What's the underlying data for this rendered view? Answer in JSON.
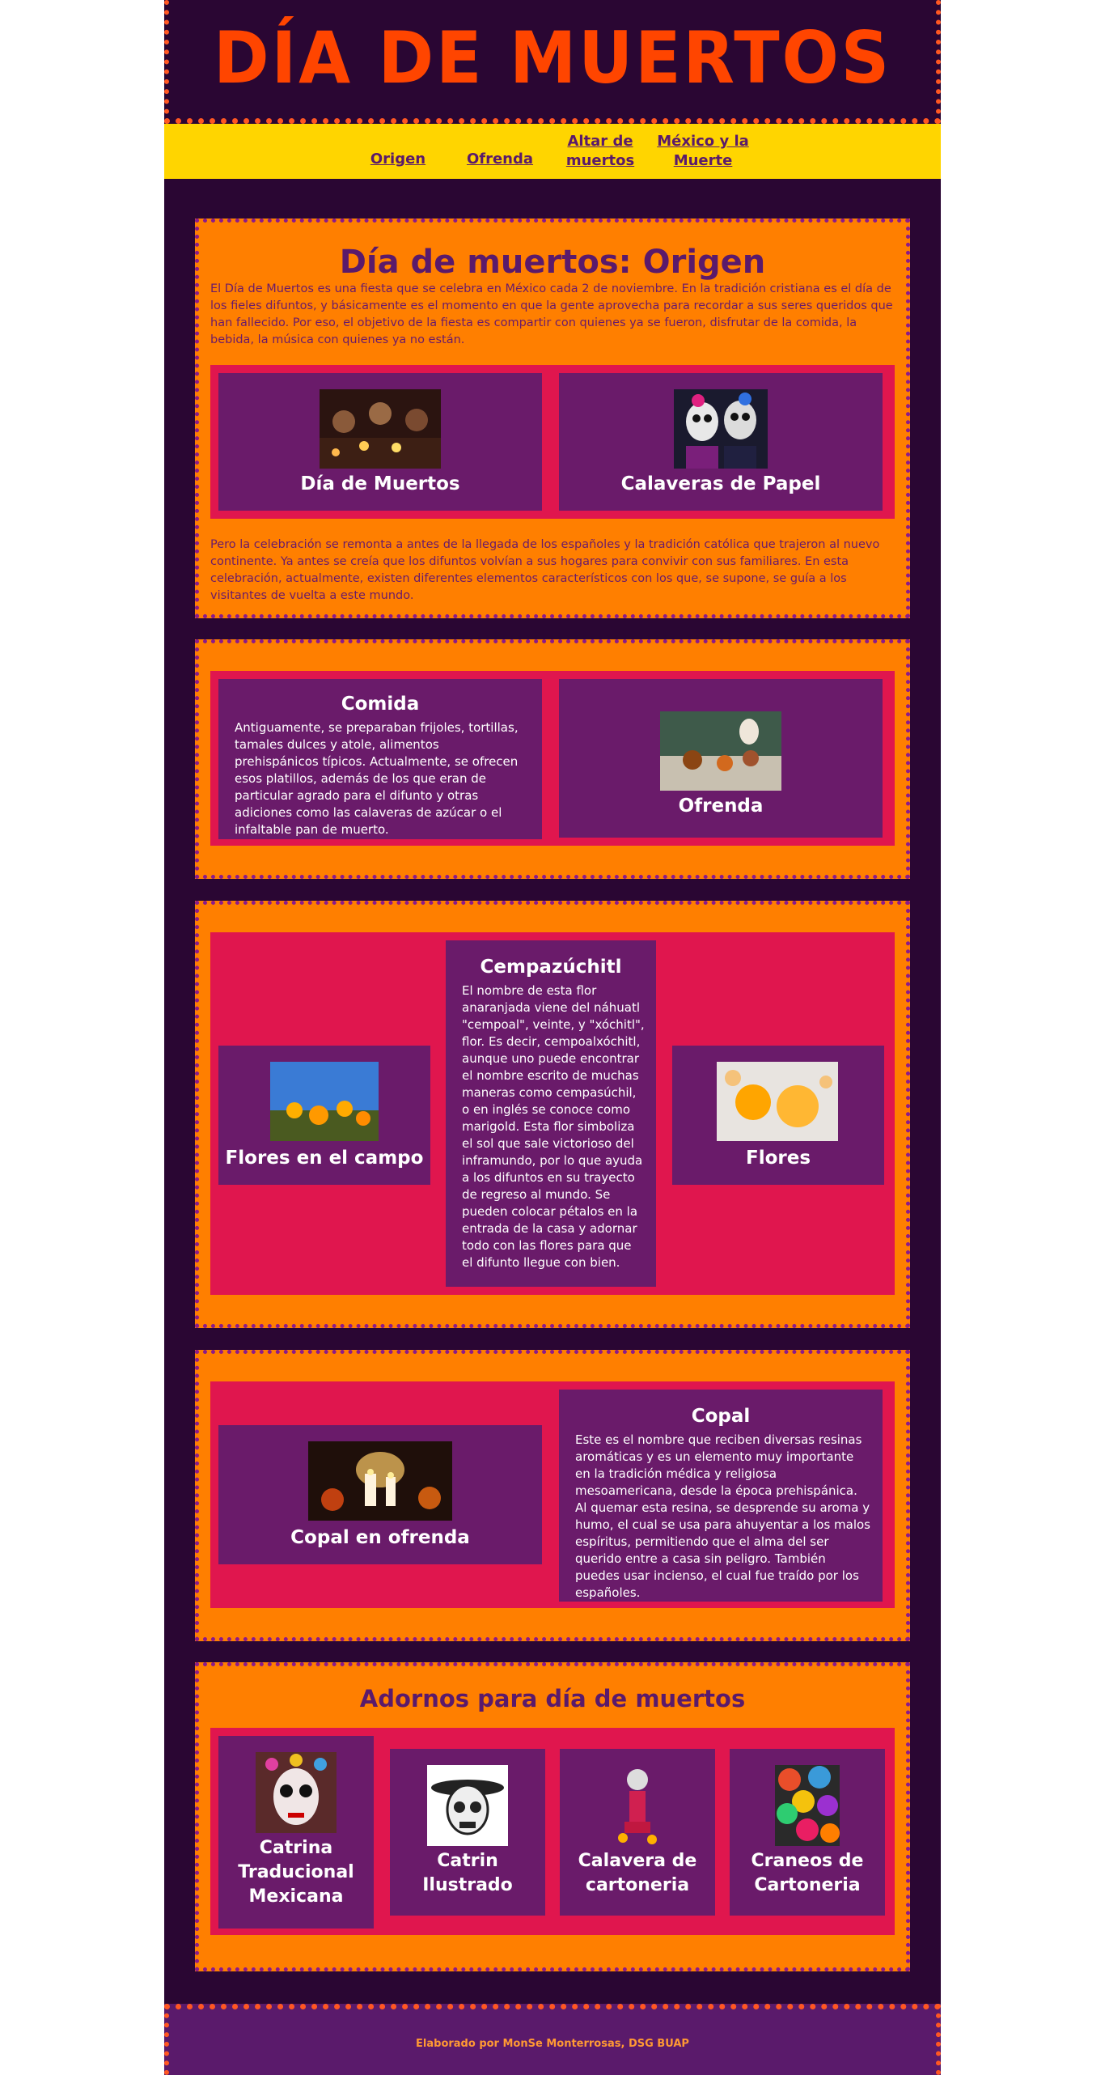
{
  "header": {
    "title": "DÍA DE MUERTOS"
  },
  "nav": {
    "items": [
      {
        "label": "Origen"
      },
      {
        "label": "Ofrenda"
      },
      {
        "label": "Altar de muertos"
      },
      {
        "label": "México y la Muerte"
      }
    ]
  },
  "origen": {
    "heading": "Día de muertos: Origen",
    "intro": "El Día de Muertos es una fiesta que se celebra en México cada 2 de noviembre. En la tradición cristiana es el día de los fieles difuntos, y básicamente es el momento en que la gente aprovecha para recordar a sus seres queridos que han fallecido. Por eso, el objetivo de la fiesta es compartir con quienes ya se fueron, disfrutar de la comida, la bebida, la música con quienes ya no están.",
    "cards": [
      {
        "title": "Día de Muertos"
      },
      {
        "title": "Calaveras de Papel"
      }
    ],
    "outro": "Pero la celebración se remonta a antes de la llegada de los españoles y la tradición católica que trajeron al nuevo continente. Ya antes se creía que los difuntos volvían a sus hogares para convivir con sus familiares. En esta celebración, actualmente, existen diferentes elementos característicos con los que, se supone, se guía a los visitantes de vuelta a este mundo."
  },
  "comida": {
    "title": "Comida",
    "text": "Antiguamente, se preparaban frijoles, tortillas, tamales dulces y atole, alimentos prehispánicos típicos. Actualmente, se ofrecen esos platillos, además de los que eran de particular agrado para el difunto y otras adiciones como las calaveras de azúcar o el infaltable pan de muerto.",
    "image_card": {
      "title": "Ofrenda"
    }
  },
  "cempazuchitl": {
    "left_card": {
      "title": "Flores en el campo"
    },
    "center": {
      "title": "Cempazúchitl",
      "text": "El nombre de esta flor anaranjada viene del náhuatl \"cempoal\", veinte, y \"xóchitl\", flor. Es decir, cempoalxóchitl, aunque uno puede encontrar el nombre escrito de muchas maneras como cempasúchil, o en inglés se conoce como marigold. Esta flor simboliza el sol que sale victorioso del inframundo, por lo que ayuda a los difuntos en su trayecto de regreso al mundo. Se pueden colocar pétalos en la entrada de la casa y adornar todo con las flores para que el difunto llegue con bien."
    },
    "right_card": {
      "title": "Flores"
    }
  },
  "copal": {
    "image_card": {
      "title": "Copal en ofrenda"
    },
    "title": "Copal",
    "text": "Este es el nombre que reciben diversas resinas aromáticas y es un elemento muy importante en la tradición médica y religiosa mesoamericana, desde la época prehispánica. Al quemar esta resina, se desprende su aroma y humo, el cual se usa para ahuyentar a los malos espíritus, permitiendo que el alma del ser querido entre a casa sin peligro. También puedes usar incienso, el cual fue traído por los españoles."
  },
  "adornos": {
    "heading": "Adornos para día de muertos",
    "cards": [
      {
        "title": "Catrina Traducional Mexicana"
      },
      {
        "title": "Catrin Ilustrado"
      },
      {
        "title": "Calavera de cartoneria"
      },
      {
        "title": "Craneos de Cartoneria"
      }
    ]
  },
  "footer": {
    "text": "Elaborado por MonSe Monterrosas, DSG BUAP"
  },
  "colors": {
    "page_bg": "#2a0633",
    "section_bg": "#ff7f00",
    "band_bg": "#e0164e",
    "card_bg": "#6a1b6a",
    "nav_bg": "#ffd500",
    "title": "#ff4500"
  }
}
